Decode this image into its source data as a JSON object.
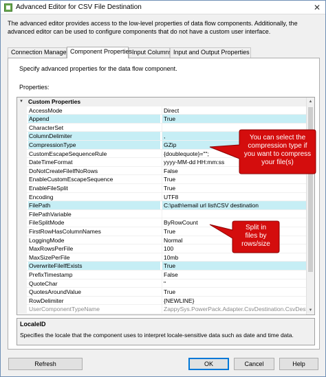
{
  "window": {
    "title": "Advanced Editor for CSV File  Destination",
    "close_glyph": "✕"
  },
  "intro": "The advanced editor provides access to the low-level properties of data flow components. Additionally, the advanced editor can be used to configure components that do not have a custom user interface.",
  "tabs": [
    {
      "label": "Connection Managers",
      "active": false
    },
    {
      "label": "Component Properties",
      "active": true
    },
    {
      "label": "Input Columns",
      "active": false
    },
    {
      "label": "Input and Output Properties",
      "active": false
    }
  ],
  "panel": {
    "description": "Specify advanced properties for the data flow component.",
    "properties_label": "Properties:"
  },
  "grid": {
    "category": "Custom Properties",
    "rows": [
      {
        "name": "AccessMode",
        "value": "Direct",
        "hl": false,
        "gray": false
      },
      {
        "name": "Append",
        "value": "True",
        "hl": true,
        "gray": false
      },
      {
        "name": "CharacterSet",
        "value": "",
        "hl": false,
        "gray": false
      },
      {
        "name": "ColumnDelimiter",
        "value": ",",
        "hl": true,
        "gray": false
      },
      {
        "name": "CompressionType",
        "value": "GZip",
        "hl": true,
        "gray": false
      },
      {
        "name": "CustomEscapeSequenceRule",
        "value": "{doublequote}=\"\";",
        "hl": false,
        "gray": false
      },
      {
        "name": "DateTimeFormat",
        "value": "yyyy-MM-dd HH:mm:ss",
        "hl": false,
        "gray": false
      },
      {
        "name": "DoNotCreateFileIfNoRows",
        "value": "False",
        "hl": false,
        "gray": false
      },
      {
        "name": "EnableCustomEscapeSequence",
        "value": "True",
        "hl": false,
        "gray": false
      },
      {
        "name": "EnableFileSplit",
        "value": "True",
        "hl": false,
        "gray": false
      },
      {
        "name": "Encoding",
        "value": "UTF8",
        "hl": false,
        "gray": false
      },
      {
        "name": "FilePath",
        "value": "C:\\path\\email url list\\CSV destination",
        "hl": true,
        "gray": false
      },
      {
        "name": "FilePathVariable",
        "value": "",
        "hl": false,
        "gray": false
      },
      {
        "name": "FileSplitMode",
        "value": "ByRowCount",
        "hl": false,
        "gray": false
      },
      {
        "name": "FirstRowHasColumnNames",
        "value": "True",
        "hl": false,
        "gray": false
      },
      {
        "name": "LoggingMode",
        "value": "Normal",
        "hl": false,
        "gray": false
      },
      {
        "name": "MaxRowsPerFile",
        "value": "100",
        "hl": false,
        "gray": false
      },
      {
        "name": "MaxSizePerFile",
        "value": "10mb",
        "hl": false,
        "gray": false
      },
      {
        "name": "OverwriteFileIfExists",
        "value": "True",
        "hl": true,
        "gray": false
      },
      {
        "name": "PrefixTimestamp",
        "value": "False",
        "hl": false,
        "gray": false
      },
      {
        "name": "QuoteChar",
        "value": "\"",
        "hl": false,
        "gray": false
      },
      {
        "name": "QuotesAroundValue",
        "value": "True",
        "hl": false,
        "gray": false
      },
      {
        "name": "RowDelimiter",
        "value": "{NEWLINE}",
        "hl": false,
        "gray": false
      },
      {
        "name": "UserComponentTypeName",
        "value": "ZappySys.PowerPack.Adapter.CsvDestination.CsvDestination",
        "hl": false,
        "gray": true
      }
    ]
  },
  "description": {
    "title": "LocaleID",
    "text": "Specifies the locale that the component uses to interpret locale-sensitive data such as date and time data."
  },
  "buttons": {
    "refresh": "Refresh",
    "ok": "OK",
    "cancel": "Cancel",
    "help": "Help"
  },
  "callouts": {
    "compression": [
      "You can select the",
      "compression type if",
      "you want to compress",
      "your file(s)"
    ],
    "split": [
      "Split in",
      "files by",
      "rows/size"
    ],
    "fill_color": "#d40d0d"
  }
}
